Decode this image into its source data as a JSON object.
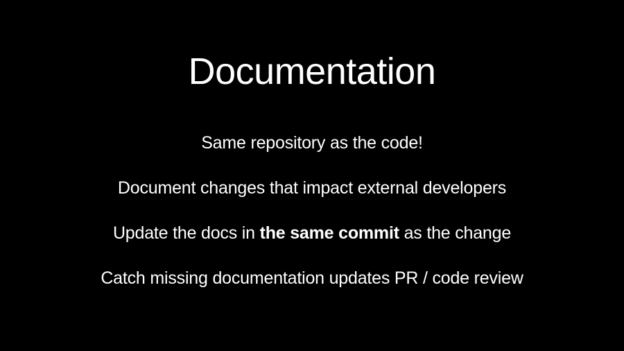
{
  "title": "Documentation",
  "bullets": [
    {
      "text": "Same repository as the code!"
    },
    {
      "text": "Document changes that impact external developers"
    },
    {
      "prefix": "Update the docs in ",
      "bold": "the same commit",
      "suffix": " as the change"
    },
    {
      "text": "Catch missing documentation updates PR / code review"
    }
  ]
}
